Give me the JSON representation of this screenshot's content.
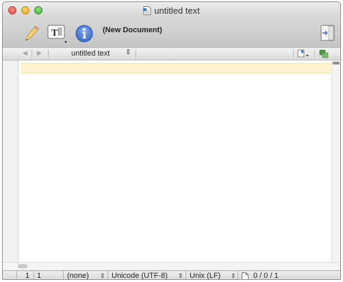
{
  "window": {
    "title": "untitled text"
  },
  "toolbar": {
    "status": "(New Document)",
    "buttons": [
      {
        "icon": "pencil-icon"
      },
      {
        "icon": "text-options-icon"
      },
      {
        "icon": "info-icon"
      },
      {
        "icon": "sidebar-toggle-icon"
      }
    ]
  },
  "navbar": {
    "document_name": "untitled text",
    "popup_glyph": "⇕"
  },
  "statusbar": {
    "line": "1",
    "column": "1",
    "language": "(none)",
    "encoding": "Unicode (UTF-8)",
    "line_endings": "Unix (LF)",
    "counts": "0 / 0 / 1",
    "popup_glyph": "⇕"
  },
  "colors": {
    "current_line": "#fdf4cf",
    "close": "#e0443e",
    "minimize": "#e0a224",
    "zoom": "#3fae36"
  }
}
